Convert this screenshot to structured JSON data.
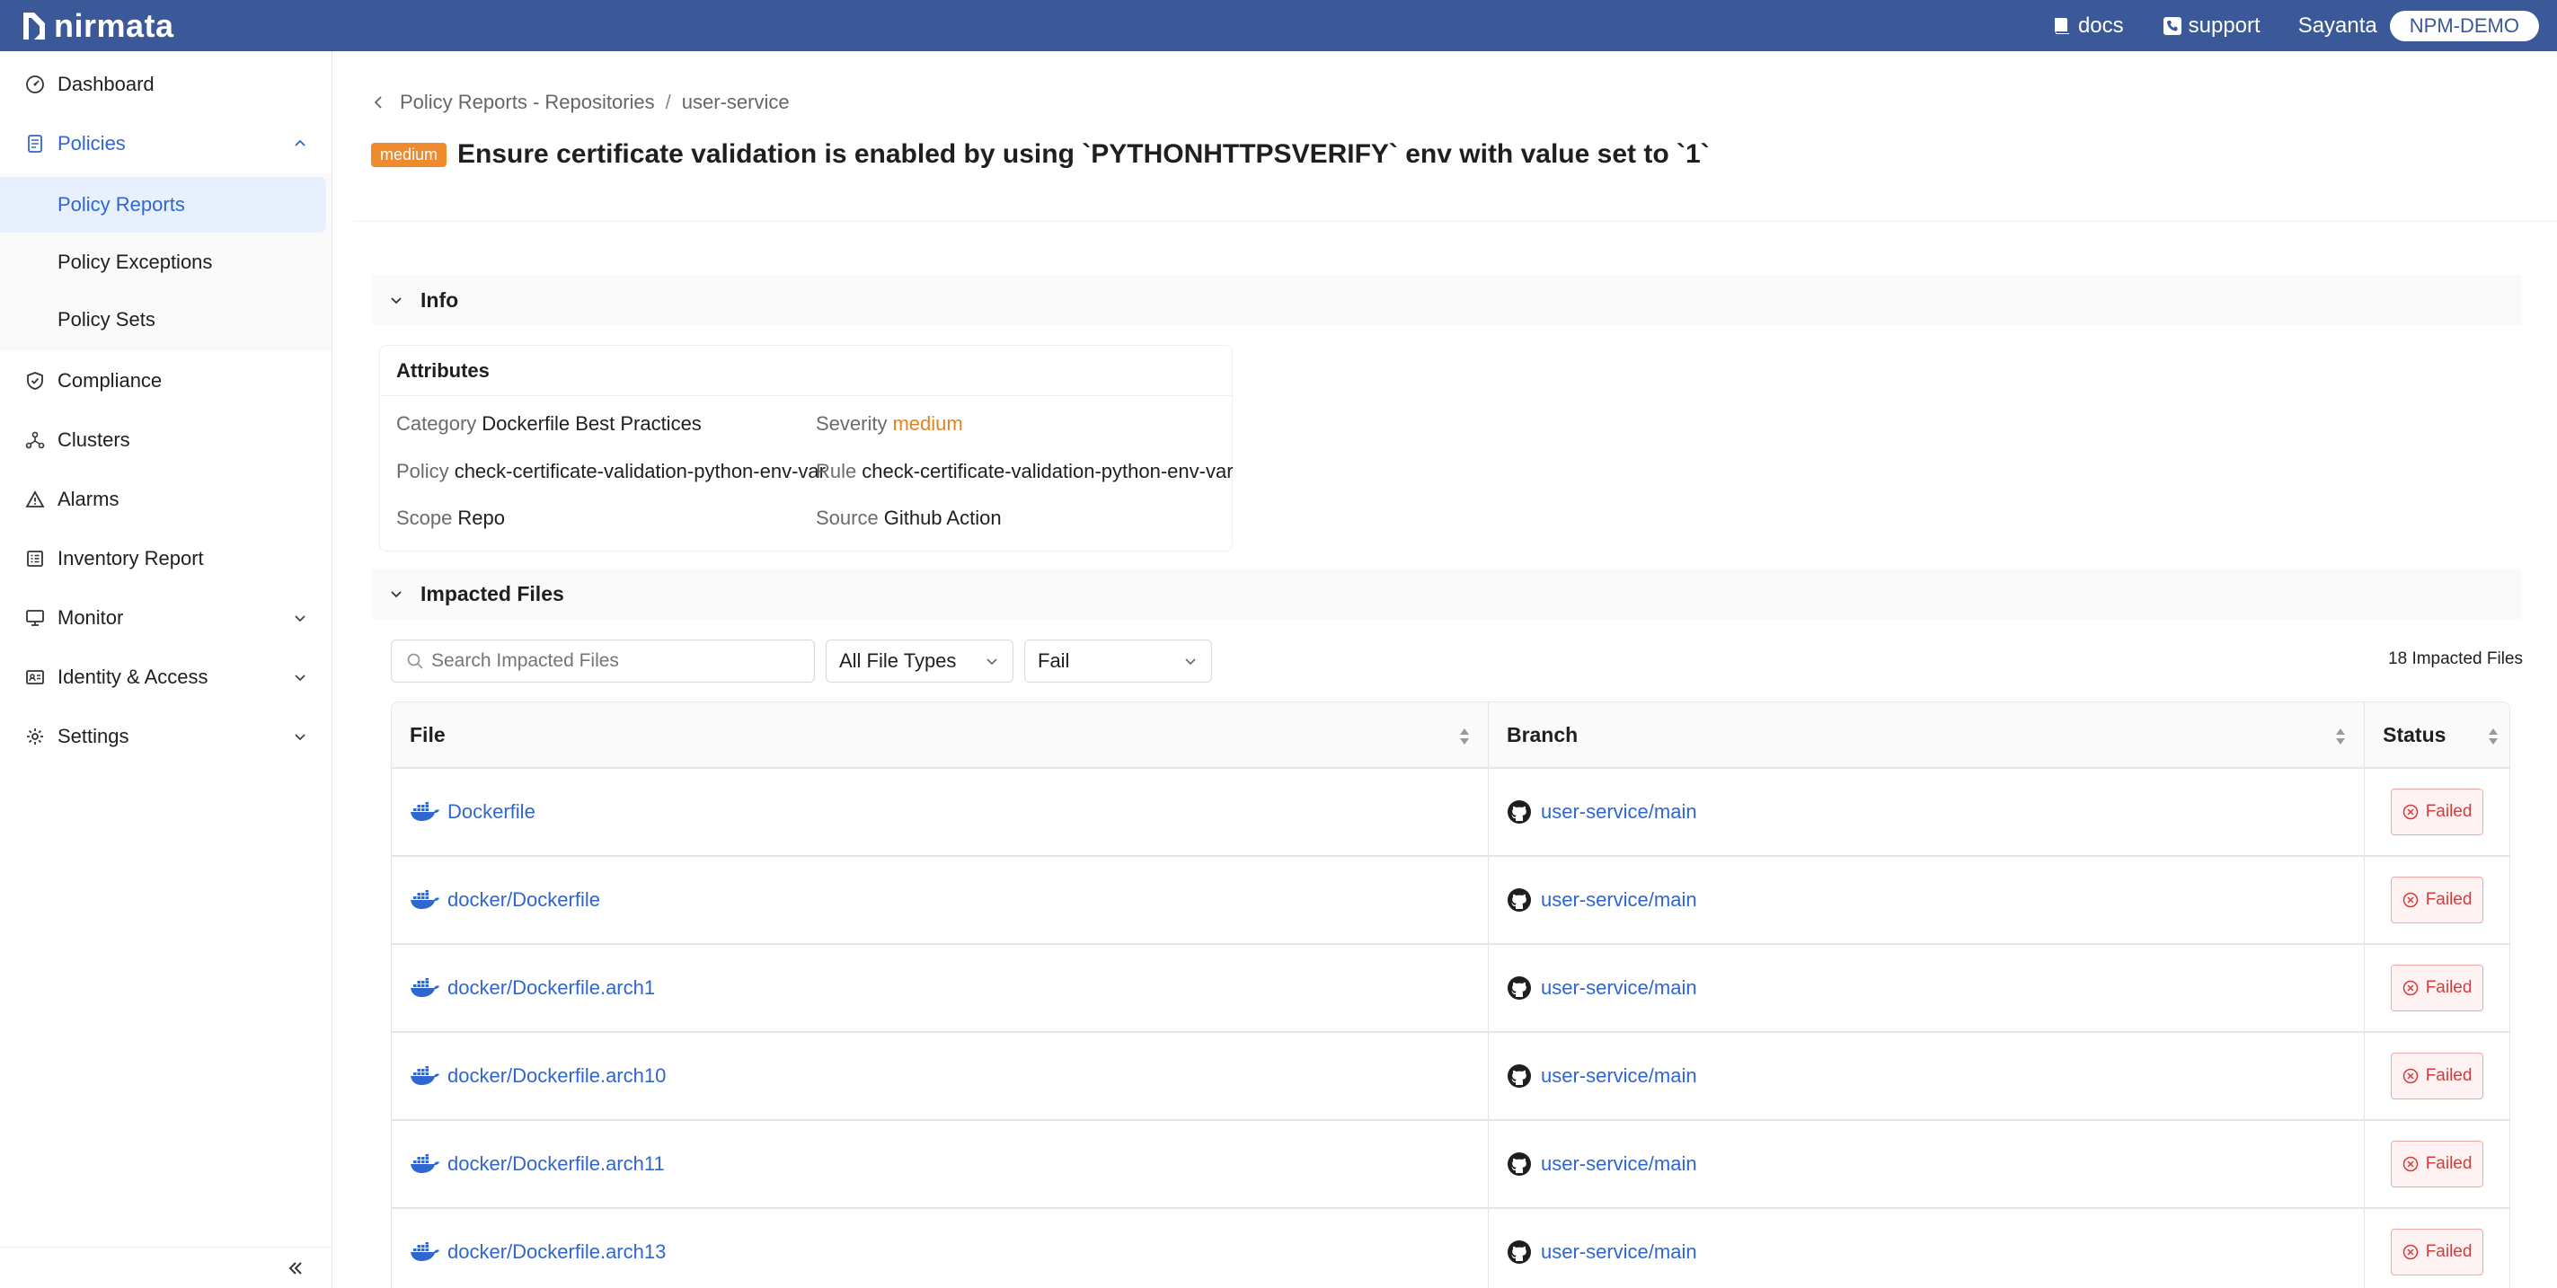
{
  "topbar": {
    "brand": "nirmata",
    "links": [
      {
        "label": "docs",
        "icon": "book-icon"
      },
      {
        "label": "support",
        "icon": "phone-icon"
      }
    ],
    "user": "Sayanta",
    "org": "NPM-DEMO"
  },
  "sidebar": {
    "items": [
      {
        "label": "Dashboard",
        "icon": "dashboard-icon"
      },
      {
        "label": "Policies",
        "icon": "policies-icon",
        "open": true,
        "children": [
          {
            "label": "Policy Reports",
            "active": true
          },
          {
            "label": "Policy Exceptions"
          },
          {
            "label": "Policy Sets"
          }
        ]
      },
      {
        "label": "Compliance",
        "icon": "shield-check-icon"
      },
      {
        "label": "Clusters",
        "icon": "clusters-icon"
      },
      {
        "label": "Alarms",
        "icon": "warning-icon"
      },
      {
        "label": "Inventory Report",
        "icon": "inventory-icon"
      },
      {
        "label": "Monitor",
        "icon": "monitor-icon",
        "expandable": true
      },
      {
        "label": "Identity & Access",
        "icon": "id-card-icon",
        "expandable": true
      },
      {
        "label": "Settings",
        "icon": "gear-icon",
        "expandable": true
      }
    ]
  },
  "breadcrumb": {
    "parent": "Policy Reports - Repositories",
    "separator": "/",
    "current": "user-service"
  },
  "header": {
    "severity_badge": "medium",
    "title": "Ensure certificate validation is enabled by using `PYTHONHTTPSVERIFY` env with value set to `1`"
  },
  "info": {
    "section_label": "Info",
    "attributes_title": "Attributes",
    "attributes": {
      "category": {
        "key": "Category",
        "value": "Dockerfile Best Practices"
      },
      "severity": {
        "key": "Severity",
        "value": "medium"
      },
      "policy": {
        "key": "Policy",
        "value": "check-certificate-validation-python-env-var"
      },
      "rule": {
        "key": "Rule",
        "value": "check-certificate-validation-python-env-var"
      },
      "scope": {
        "key": "Scope",
        "value": "Repo"
      },
      "source": {
        "key": "Source",
        "value": "Github Action"
      }
    }
  },
  "impacted": {
    "section_label": "Impacted Files",
    "search_placeholder": "Search Impacted Files",
    "file_type_filter": "All File Types",
    "status_filter": "Fail",
    "count_label": "18 Impacted Files",
    "columns": [
      "File",
      "Branch",
      "Status"
    ],
    "rows": [
      {
        "file": "Dockerfile",
        "branch": "user-service/main",
        "status": "Failed"
      },
      {
        "file": "docker/Dockerfile",
        "branch": "user-service/main",
        "status": "Failed"
      },
      {
        "file": "docker/Dockerfile.arch1",
        "branch": "user-service/main",
        "status": "Failed"
      },
      {
        "file": "docker/Dockerfile.arch10",
        "branch": "user-service/main",
        "status": "Failed"
      },
      {
        "file": "docker/Dockerfile.arch11",
        "branch": "user-service/main",
        "status": "Failed"
      },
      {
        "file": "docker/Dockerfile.arch13",
        "branch": "user-service/main",
        "status": "Failed"
      }
    ]
  },
  "colors": {
    "topbar": "#3b5998",
    "accent": "#2f66d0",
    "severity_medium": "#ef8a2e",
    "failed": "#d43b3b"
  }
}
